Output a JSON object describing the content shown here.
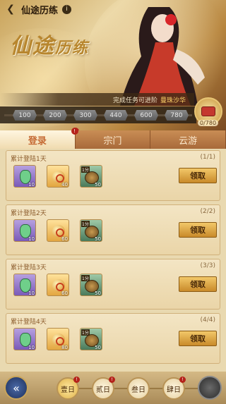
{
  "header": {
    "title": "仙途历练",
    "info_icon": "i"
  },
  "logo": {
    "text_a": "仙途",
    "text_b": "历练"
  },
  "quest": {
    "text": "完成任务可进阶",
    "name": "曼珠沙华"
  },
  "progress": {
    "milestones": [
      "100",
      "200",
      "300",
      "440",
      "600",
      "780"
    ],
    "count": "0/780"
  },
  "tabs": [
    {
      "label": "登录",
      "badge": "!"
    },
    {
      "label": "宗门",
      "badge": "!"
    },
    {
      "label": "云游",
      "badge": ""
    }
  ],
  "cards": [
    {
      "title": "累计登陆1天",
      "progress": "(1/1)",
      "items": [
        "10",
        "40",
        "50"
      ],
      "tag": "1分",
      "claim": "领取"
    },
    {
      "title": "累计登陆2天",
      "progress": "(2/2)",
      "items": [
        "10",
        "60",
        "50"
      ],
      "tag": "1分",
      "claim": "领取"
    },
    {
      "title": "累计登陆3天",
      "progress": "(3/3)",
      "items": [
        "10",
        "60",
        "50"
      ],
      "tag": "1分",
      "claim": "领取"
    },
    {
      "title": "累计登陆4天",
      "progress": "(4/4)",
      "items": [
        "10",
        "80",
        "50"
      ],
      "tag": "1分",
      "claim": "领取"
    }
  ],
  "days": [
    "壹日",
    "贰日",
    "叁日",
    "肆日"
  ],
  "day_badges": [
    "!",
    "!",
    "",
    "!"
  ],
  "colors": {
    "accent": "#c56a34",
    "claim": "#f2c869",
    "badge": "#b5221a"
  }
}
